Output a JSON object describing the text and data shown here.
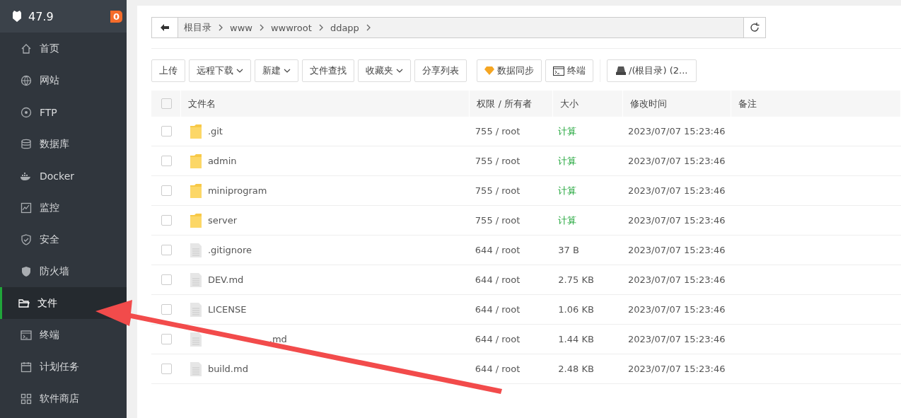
{
  "sidebar": {
    "server_title": "47.9",
    "badge": "0",
    "items": [
      {
        "label": "首页",
        "selected": false
      },
      {
        "label": "网站",
        "selected": false
      },
      {
        "label": "FTP",
        "selected": false
      },
      {
        "label": "数据库",
        "selected": false
      },
      {
        "label": "Docker",
        "selected": false
      },
      {
        "label": "监控",
        "selected": false
      },
      {
        "label": "安全",
        "selected": false
      },
      {
        "label": "防火墙",
        "selected": false
      },
      {
        "label": "文件",
        "selected": true
      },
      {
        "label": "终端",
        "selected": false
      },
      {
        "label": "计划任务",
        "selected": false
      },
      {
        "label": "软件商店",
        "selected": false
      }
    ]
  },
  "breadcrumb": [
    "根目录",
    "www",
    "wwwroot",
    "ddapp"
  ],
  "toolbar": [
    {
      "label": "上传",
      "dropdown": false
    },
    {
      "label": "远程下载",
      "dropdown": true
    },
    {
      "label": "新建",
      "dropdown": true
    },
    {
      "label": "文件查找",
      "dropdown": false
    },
    {
      "label": "收藏夹",
      "dropdown": true
    },
    {
      "label": "分享列表",
      "dropdown": false
    },
    {
      "label": "数据同步",
      "dropdown": false
    },
    {
      "label": "终端",
      "dropdown": false
    }
  ],
  "disk_button": "/(根目录) (2...",
  "table": {
    "select_all": false,
    "columns": [
      "文件名",
      "权限 / 所有者",
      "大小",
      "修改时间",
      "备注"
    ],
    "rows": [
      {
        "kind": "folder",
        "name": ".git",
        "perm": "755 / root",
        "size": "计算",
        "size_link": true,
        "modified": "2023/07/07 15:23:46",
        "checked": false
      },
      {
        "kind": "folder",
        "name": "admin",
        "perm": "755 / root",
        "size": "计算",
        "size_link": true,
        "modified": "2023/07/07 15:23:46",
        "checked": false
      },
      {
        "kind": "folder",
        "name": "miniprogram",
        "perm": "755 / root",
        "size": "计算",
        "size_link": true,
        "modified": "2023/07/07 15:23:46",
        "checked": false
      },
      {
        "kind": "folder",
        "name": "server",
        "perm": "755 / root",
        "size": "计算",
        "size_link": true,
        "modified": "2023/07/07 15:23:46",
        "checked": false
      },
      {
        "kind": "file",
        "name": ".gitignore",
        "perm": "644 / root",
        "size": "37 B",
        "size_link": false,
        "modified": "2023/07/07 15:23:46",
        "checked": false
      },
      {
        "kind": "file",
        "name": "DEV.md",
        "perm": "644 / root",
        "size": "2.75 KB",
        "size_link": false,
        "modified": "2023/07/07 15:23:46",
        "checked": false
      },
      {
        "kind": "file",
        "name": "LICENSE",
        "perm": "644 / root",
        "size": "1.06 KB",
        "size_link": false,
        "modified": "2023/07/07 15:23:46",
        "checked": false
      },
      {
        "kind": "file",
        "name": ".md",
        "start_hidden": true,
        "perm": "644 / root",
        "size": "1.44 KB",
        "size_link": false,
        "modified": "2023/07/07 15:23:46",
        "checked": false
      },
      {
        "kind": "file",
        "name": "build.md",
        "perm": "644 / root",
        "size": "2.48 KB",
        "size_link": false,
        "modified": "2023/07/07 15:23:46",
        "checked": false
      }
    ]
  }
}
